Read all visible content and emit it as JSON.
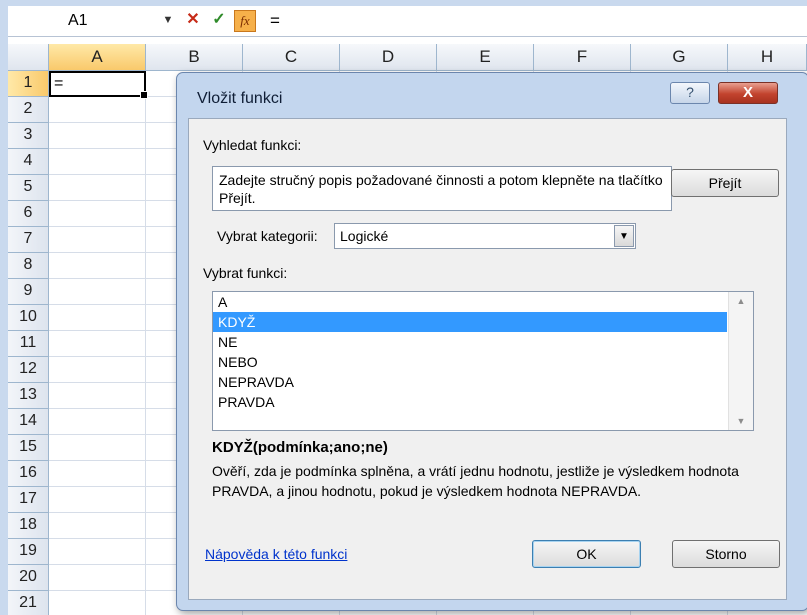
{
  "formula_bar": {
    "name_box": "A1",
    "cancel_icon": "✕",
    "enter_icon": "✓",
    "fx_icon": "fx",
    "formula": "="
  },
  "sheet": {
    "columns": [
      "A",
      "B",
      "C",
      "D",
      "E",
      "F",
      "G",
      "H"
    ],
    "rows": [
      "1",
      "2",
      "3",
      "4",
      "5",
      "6",
      "7",
      "8",
      "9",
      "10",
      "11",
      "12",
      "13",
      "14",
      "15",
      "16",
      "17",
      "18",
      "19",
      "20",
      "21"
    ],
    "active_cell_value": "="
  },
  "dialog": {
    "title": "Vložit funkci",
    "help_button": "?",
    "close_button": "X",
    "search_label": "Vyhledat funkci:",
    "search_text": "Zadejte stručný popis požadované činnosti a potom klepněte na tlačítko Přejít.",
    "go_button": "Přejít",
    "category_label": "Vybrat kategorii:",
    "category_value": "Logické",
    "function_label": "Vybrat funkci:",
    "functions": [
      "A",
      "KDYŽ",
      "NE",
      "NEBO",
      "NEPRAVDA",
      "PRAVDA"
    ],
    "selected_function": "KDYŽ",
    "signature": "KDYŽ(podmínka;ano;ne)",
    "description": "Ověří, zda je podmínka splněna, a vrátí jednu hodnotu, jestliže je výsledkem hodnota PRAVDA, a jinou hodnotu, pokud je výsledkem hodnota NEPRAVDA.",
    "help_link": "Nápověda k této funkci",
    "ok_button": "OK",
    "cancel_button": "Storno"
  },
  "colors": {
    "dialog_frame": "#c3d6ee",
    "selection": "#3399ff",
    "header_selected": "#f9c96b",
    "close_button": "#c2432e",
    "link": "#0033cc"
  }
}
